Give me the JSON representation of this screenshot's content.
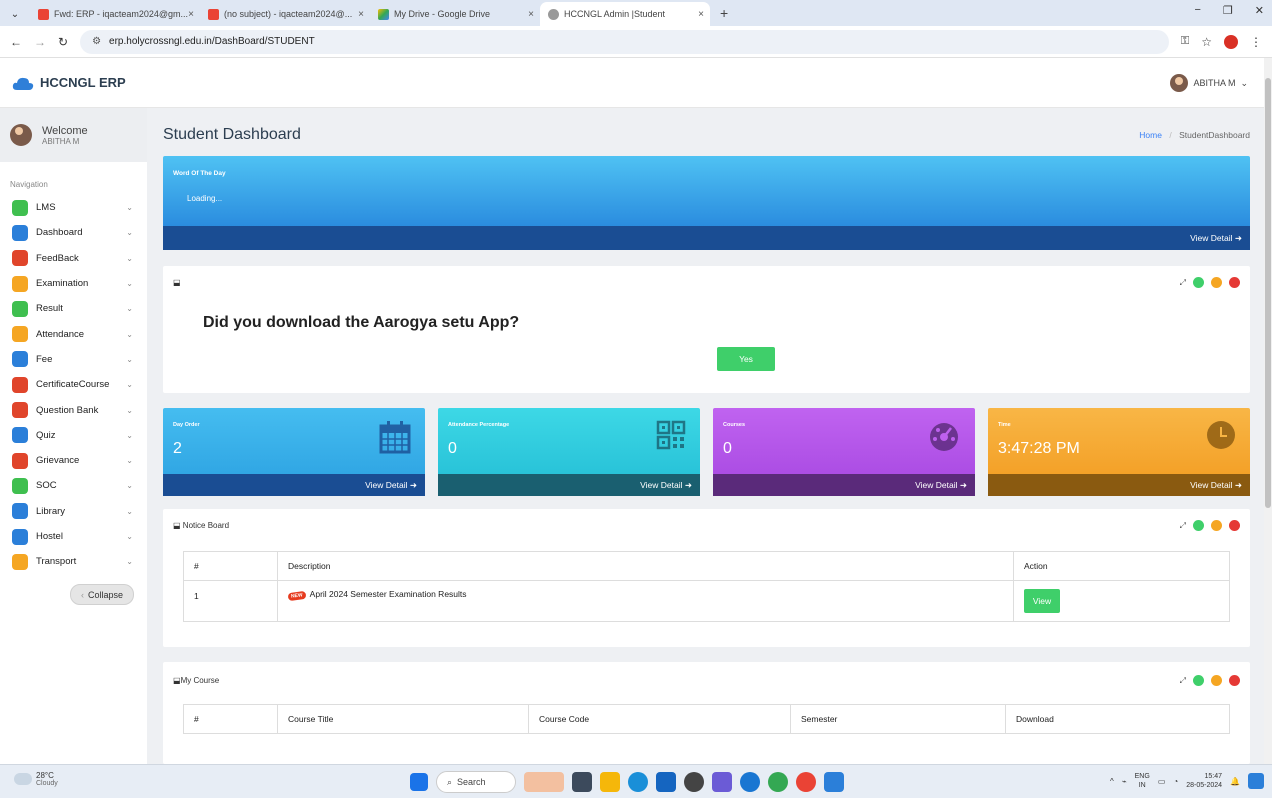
{
  "browser": {
    "tabs": [
      {
        "label": "Fwd: ERP - iqacteam2024@gm...",
        "icon": "gmail-icon"
      },
      {
        "label": "(no subject) - iqacteam2024@...",
        "icon": "gmail-icon"
      },
      {
        "label": "My Drive - Google Drive",
        "icon": "google-drive-icon"
      },
      {
        "label": "HCCNGL Admin |Student",
        "icon": "site-icon"
      }
    ],
    "url": "erp.holycrossngl.edu.in/DashBoard/STUDENT"
  },
  "app": {
    "brand": "HCCNGL ERP",
    "user_name": "ABITHA M"
  },
  "sidebar": {
    "welcome": "Welcome",
    "welcome_user": "ABITHA M",
    "nav_heading": "Navigation",
    "items": [
      {
        "label": "LMS",
        "color": "#3fbf4f",
        "icon": "book-icon"
      },
      {
        "label": "Dashboard",
        "color": "#2b7fd9",
        "icon": "pulse-icon"
      },
      {
        "label": "FeedBack",
        "color": "#e0452b",
        "icon": "rss-icon"
      },
      {
        "label": "Examination",
        "color": "#f5a623",
        "icon": "book-icon"
      },
      {
        "label": "Result",
        "color": "#3fbf4f",
        "icon": "table-icon"
      },
      {
        "label": "Attendance",
        "color": "#f5a623",
        "icon": "clock-icon"
      },
      {
        "label": "Fee",
        "color": "#2b7fd9",
        "icon": "rupee-icon"
      },
      {
        "label": "CertificateCourse",
        "color": "#e0452b",
        "icon": "rss-icon"
      },
      {
        "label": "Question Bank",
        "color": "#e0452b",
        "icon": "book-icon"
      },
      {
        "label": "Quiz",
        "color": "#2b7fd9",
        "icon": "target-icon"
      },
      {
        "label": "Grievance",
        "color": "#e0452b",
        "icon": "rss-icon"
      },
      {
        "label": "SOC",
        "color": "#3fbf4f",
        "icon": "table-icon"
      },
      {
        "label": "Library",
        "color": "#2b7fd9",
        "icon": "target-icon"
      },
      {
        "label": "Hostel",
        "color": "#2b7fd9",
        "icon": "edit-icon"
      },
      {
        "label": "Transport",
        "color": "#f5a623",
        "icon": "book-icon"
      }
    ],
    "collapse": "Collapse"
  },
  "main": {
    "title": "Student Dashboard",
    "breadcrumb_home": "Home",
    "breadcrumb_sep": "/",
    "breadcrumb_current": "StudentDashboard",
    "word_of_day": {
      "heading": "Word Of The Day",
      "text": "Loading...",
      "footer": "View Detail"
    },
    "aarogya": {
      "question": "Did you download the Aarogya setu App?",
      "yes": "Yes"
    },
    "stats": [
      {
        "label": "Day Order",
        "value": "2",
        "footer": "View Detail",
        "icon": "calendar-icon"
      },
      {
        "label": "Attendance Percentage",
        "value": "0",
        "footer": "View Detail",
        "icon": "qr-code-icon"
      },
      {
        "label": "Courses",
        "value": "0",
        "footer": "View Detail",
        "icon": "dashboard-gauge-icon"
      },
      {
        "label": "Time",
        "value": "3:47:28 PM",
        "footer": "View Detail",
        "icon": "clock-icon"
      }
    ],
    "notice_board": {
      "title": "Notice Board",
      "headers": [
        "#",
        "Description",
        "Action"
      ],
      "rows": [
        {
          "num": "1",
          "badge": "NEW",
          "description": "April 2024 Semester Examination Results",
          "action": "View"
        }
      ]
    },
    "my_course": {
      "title": "My Course",
      "headers": [
        "#",
        "Course Title",
        "Course Code",
        "Semester",
        "Download"
      ]
    }
  },
  "taskbar": {
    "weather_temp": "28°C",
    "weather_text": "Cloudy",
    "search": "Search",
    "lang": "ENG",
    "region": "IN",
    "time": "15:47",
    "date": "28-05-2024"
  }
}
